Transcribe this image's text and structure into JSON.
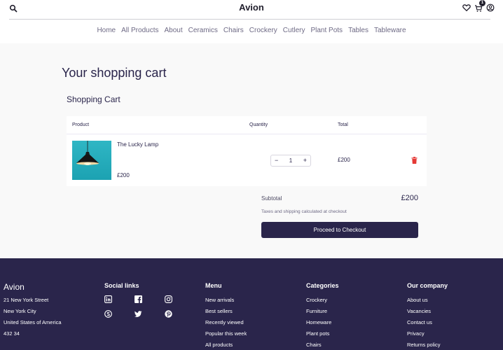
{
  "header": {
    "brand": "Avion",
    "cart_count": "1",
    "icons": [
      "search-icon",
      "heart-icon",
      "cart-icon",
      "user-icon"
    ]
  },
  "nav": {
    "items": [
      "Home",
      "All Products",
      "About",
      "Ceramics",
      "Chairs",
      "Crockery",
      "Cutlery",
      "Plant Pots",
      "Tables",
      "Tableware"
    ]
  },
  "cart": {
    "page_title": "Your shopping cart",
    "section_title": "Shopping Cart",
    "columns": {
      "product": "Product",
      "quantity": "Quantity",
      "total": "Total"
    },
    "items": [
      {
        "name": "The Lucky Lamp",
        "price": "£200",
        "quantity": "1",
        "total": "£200"
      }
    ],
    "qty_minus": "−",
    "qty_plus": "+",
    "subtotal_label": "Subtotal",
    "subtotal_value": "£200",
    "tax_note": "Taxes and shipping calculated at checkout",
    "checkout_label": "Proceed to Checkout"
  },
  "footer": {
    "brand": "Avion",
    "address": [
      "21 New York Street",
      "New York City",
      "United States of America",
      "432 34"
    ],
    "social_heading": "Social links",
    "social_icons": [
      "linkedin-icon",
      "facebook-icon",
      "instagram-icon",
      "skype-icon",
      "twitter-icon",
      "pinterest-icon"
    ],
    "menu_heading": "Menu",
    "menu": [
      "New arrivals",
      "Best sellers",
      "Recently viewed",
      "Popular this week",
      "All products"
    ],
    "categories_heading": "Categories",
    "categories": [
      "Crockery",
      "Furniture",
      "Homeware",
      "Plant pots",
      "Chairs"
    ],
    "company_heading": "Our company",
    "company": [
      "About us",
      "Vacancies",
      "Contact us",
      "Privacy",
      "Returns policy"
    ]
  },
  "colors": {
    "primary": "#2a254b",
    "page_bg": "#f9f9f9",
    "delete": "#e53935",
    "lamp_bg": "#1fa9b8"
  }
}
